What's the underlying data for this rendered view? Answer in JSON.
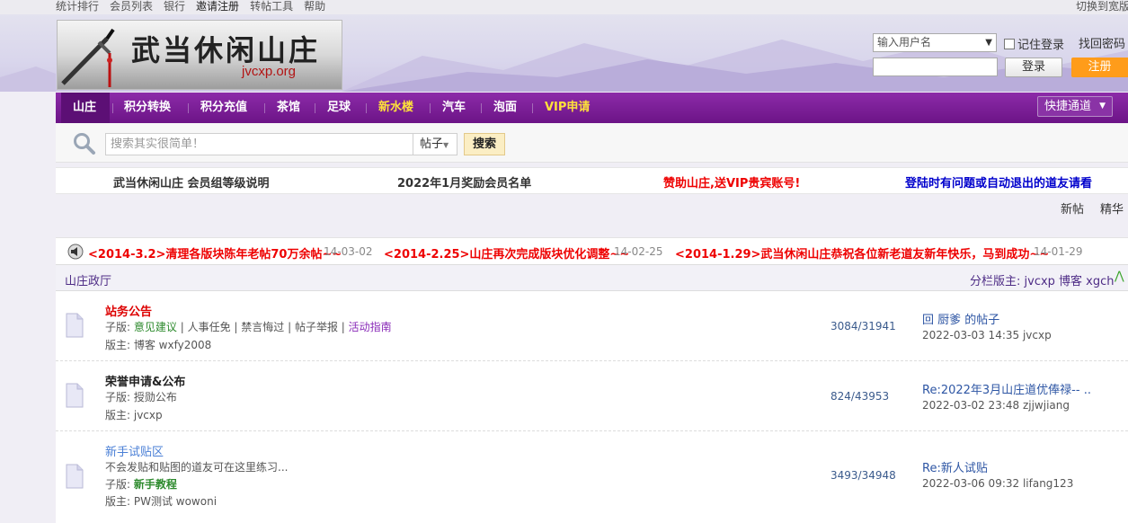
{
  "topbar": {
    "links": [
      "统计排行",
      "会员列表",
      "银行",
      "邀请注册",
      "转帖工具",
      "帮助"
    ],
    "switch_label": "切换到宽版"
  },
  "logo": {
    "title": "武当休闲山庄",
    "url": "jvcxp.org"
  },
  "login": {
    "username_placeholder": "输入用户名",
    "remember_label": "记住登录",
    "forgot_label": "找回密码",
    "login_button": "登录",
    "register_button": "注册"
  },
  "nav": {
    "items": [
      "山庄",
      "积分转换",
      "积分充值",
      "茶馆",
      "足球",
      "新水楼",
      "汽车",
      "泡面",
      "VIP申请"
    ],
    "quick": "快捷通道"
  },
  "search": {
    "placeholder": "搜索其实很简单！",
    "type": "帖子",
    "button": "搜索"
  },
  "notices": [
    {
      "text": "武当休闲山庄 会员组等级说明",
      "color": "#222222"
    },
    {
      "text": "2022年1月奖励会员名单",
      "color": "#222222"
    },
    {
      "text": "赞助山庄,送VIP贵宾账号!",
      "color": "#ee0000"
    },
    {
      "text": "登陆时有问题或自动退出的道友请看",
      "color": "#0000cc"
    }
  ],
  "sublinks": [
    "新帖",
    "精华"
  ],
  "announcements": [
    {
      "text": "<2014-3.2>清理各版块陈年老帖70万余帖~~",
      "date": "14-03-02"
    },
    {
      "text": "<2014-2.25>山庄再次完成版块优化调整~~",
      "date": "14-02-25"
    },
    {
      "text": "<2014-1.29>武当休闲山庄恭祝各位新老道友新年快乐，马到成功~~",
      "date": "14-01-29"
    }
  ],
  "section": {
    "title": "山庄政厅",
    "moderators": "分栏版主: jvcxp 博客 xgch"
  },
  "forums": [
    {
      "name": "站务公告",
      "name_color": "#dd0000",
      "sub_prefix": "子版:",
      "subs": [
        "意见建议",
        "人事任免",
        "禁言悔过",
        "帖子举报",
        "活动指南"
      ],
      "moderator": "版主: 博客 wxfy2008",
      "count": "3084/31941",
      "last_title": "回 厨爹 的帖子",
      "last_info": "2022-03-03 14:35 jvcxp"
    },
    {
      "name": "荣誉申请&公布",
      "name_color": "#222222",
      "sub_line": "子版: 授勋公布",
      "moderator": "版主: jvcxp",
      "count": "824/43953",
      "last_title": "Re:2022年3月山庄道优俸禄-- ..",
      "last_info": "2022-03-02 23:48 zjjwjiang"
    },
    {
      "name": "新手试贴区",
      "name_color": "#4a7fd6",
      "desc": "不会发贴和贴图的道友可在这里练习...",
      "sub_prefix": "子版:",
      "sub": "新手教程",
      "moderator": "版主: PW测试 wowoni",
      "count": "3493/34948",
      "last_title": "Re:新人试贴",
      "last_info": "2022-03-06 09:32 lifang123"
    }
  ]
}
